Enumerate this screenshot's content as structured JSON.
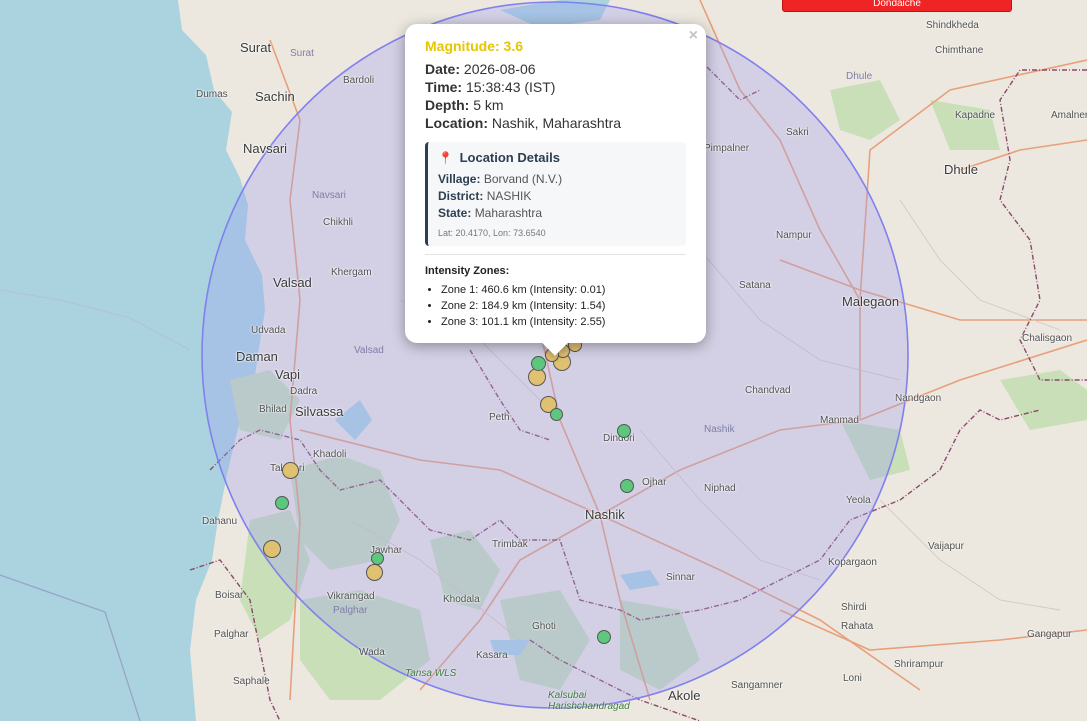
{
  "map": {
    "top_banner_text": "Dondaiche",
    "places": [
      {
        "name": "Surat",
        "cls": "city"
      },
      {
        "name": "Surat",
        "cls": "area"
      },
      {
        "name": "Dumas",
        "cls": "town"
      },
      {
        "name": "Sachin",
        "cls": "city"
      },
      {
        "name": "Bardoli",
        "cls": "town"
      },
      {
        "name": "Navsari",
        "cls": "city"
      },
      {
        "name": "Navsari",
        "cls": "area"
      },
      {
        "name": "Chikhli",
        "cls": "town"
      },
      {
        "name": "Khergam",
        "cls": "town"
      },
      {
        "name": "Valsad",
        "cls": "city"
      },
      {
        "name": "Udvada",
        "cls": "town"
      },
      {
        "name": "Daman",
        "cls": "city"
      },
      {
        "name": "Vapi",
        "cls": "city"
      },
      {
        "name": "Valsad",
        "cls": "area"
      },
      {
        "name": "Dadra",
        "cls": "town"
      },
      {
        "name": "Bhilad",
        "cls": "town"
      },
      {
        "name": "Silvassa",
        "cls": "city"
      },
      {
        "name": "Khadoli",
        "cls": "town"
      },
      {
        "name": "Talasari",
        "cls": "town"
      },
      {
        "name": "Dahanu",
        "cls": "town"
      },
      {
        "name": "Jawhar",
        "cls": "town"
      },
      {
        "name": "Boisar",
        "cls": "town"
      },
      {
        "name": "Vikramgad",
        "cls": "town"
      },
      {
        "name": "Palghar",
        "cls": "area"
      },
      {
        "name": "Palghar",
        "cls": "town"
      },
      {
        "name": "Wada",
        "cls": "town"
      },
      {
        "name": "Saphale",
        "cls": "town"
      },
      {
        "name": "Khodala",
        "cls": "town"
      },
      {
        "name": "Kasara",
        "cls": "town"
      },
      {
        "name": "Tansa WLS",
        "cls": "green"
      },
      {
        "name": "Ghoti",
        "cls": "town"
      },
      {
        "name": "Trimbak",
        "cls": "town"
      },
      {
        "name": "Peth",
        "cls": "town"
      },
      {
        "name": "Nashik",
        "cls": "city"
      },
      {
        "name": "Nashik",
        "cls": "area"
      },
      {
        "name": "Dindori",
        "cls": "town"
      },
      {
        "name": "Ojhar",
        "cls": "town"
      },
      {
        "name": "Niphad",
        "cls": "town"
      },
      {
        "name": "Sinnar",
        "cls": "town"
      },
      {
        "name": "Chandvad",
        "cls": "town"
      },
      {
        "name": "Manmad",
        "cls": "town"
      },
      {
        "name": "Yeola",
        "cls": "town"
      },
      {
        "name": "Satana",
        "cls": "town"
      },
      {
        "name": "Nampur",
        "cls": "town"
      },
      {
        "name": "Malegaon",
        "cls": "city"
      },
      {
        "name": "Nandgaon",
        "cls": "town"
      },
      {
        "name": "Kopargaon",
        "cls": "town"
      },
      {
        "name": "Vaijapur",
        "cls": "town"
      },
      {
        "name": "Shirdi",
        "cls": "town"
      },
      {
        "name": "Rahata",
        "cls": "town"
      },
      {
        "name": "Shrirampur",
        "cls": "town"
      },
      {
        "name": "Sangamner",
        "cls": "town"
      },
      {
        "name": "Akole",
        "cls": "city"
      },
      {
        "name": "Loni",
        "cls": "town"
      },
      {
        "name": "Gangapur",
        "cls": "town"
      },
      {
        "name": "Dhule",
        "cls": "city"
      },
      {
        "name": "Dhule",
        "cls": "area"
      },
      {
        "name": "Sakri",
        "cls": "town"
      },
      {
        "name": "Pimpalner",
        "cls": "town"
      },
      {
        "name": "Chimthane",
        "cls": "town"
      },
      {
        "name": "Shindkheda",
        "cls": "town"
      },
      {
        "name": "Kapadne",
        "cls": "town"
      },
      {
        "name": "Amalner",
        "cls": "town"
      },
      {
        "name": "Chalisgaon",
        "cls": "town"
      },
      {
        "name": "Kalsubai Harishchandragad",
        "cls": "green"
      }
    ],
    "markers": [
      {
        "color": "#e0c071"
      },
      {
        "color": "#e0c071"
      },
      {
        "color": "#e0c071"
      },
      {
        "color": "#e0c071"
      },
      {
        "color": "#5cc77d"
      },
      {
        "color": "#e0c071"
      },
      {
        "color": "#e0c071"
      },
      {
        "color": "#5cc77d"
      },
      {
        "color": "#5cc77d"
      },
      {
        "color": "#5cc77d"
      },
      {
        "color": "#e0c071"
      },
      {
        "color": "#5cc77d"
      },
      {
        "color": "#e0c071"
      },
      {
        "color": "#5cc77d"
      },
      {
        "color": "#e0c071"
      },
      {
        "color": "#5cc77d"
      }
    ],
    "colors": {
      "sea": "#aad3df",
      "land": "#ece8e0",
      "forest": "#c8dfb8",
      "circle_fill": "#9f9ff0",
      "circle_stroke": "#8080ee",
      "state_border": "#8a4a6a",
      "road": "#e7a07a"
    }
  },
  "popup": {
    "close_symbol": "×",
    "magnitude_label": "Magnitude: 3.6",
    "date_label": "Date:",
    "date_value": "2026-08-06",
    "time_label": "Time:",
    "time_value": "15:38:43 (IST)",
    "depth_label": "Depth:",
    "depth_value": "5 km",
    "location_label": "Location:",
    "location_value": "Nashik, Maharashtra",
    "details_icon": "📍",
    "details_title": "Location Details",
    "village_label": "Village:",
    "village_value": "Borvand (N.V.)",
    "district_label": "District:",
    "district_value": "NASHIK",
    "state_label": "State:",
    "state_value": "Maharashtra",
    "coords_text": "Lat: 20.4170, Lon: 73.6540",
    "zones_title": "Intensity Zones:",
    "zones": [
      {
        "text": "Zone 1: 460.6 km (Intensity: 0.01)"
      },
      {
        "text": "Zone 2: 184.9 km (Intensity: 1.54)"
      },
      {
        "text": "Zone 3: 101.1 km (Intensity: 2.55)"
      }
    ]
  }
}
